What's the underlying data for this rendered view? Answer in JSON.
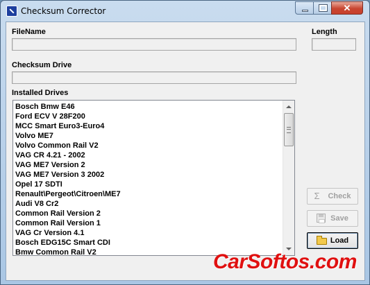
{
  "window": {
    "title": "Checksum Corrector",
    "close_glyph": "✕"
  },
  "fields": {
    "filename_label": "FileName",
    "filename_value": "",
    "length_label": "Length",
    "length_value": "",
    "checksum_drive_label": "Checksum Drive",
    "checksum_drive_value": ""
  },
  "drives": {
    "label": "Installed Drives",
    "items": [
      "Bosch Bmw E46",
      "Ford ECV V 28F200",
      "MCC Smart Euro3-Euro4",
      "Volvo ME7",
      "Volvo Common Rail V2",
      "VAG CR 4.21 - 2002",
      "VAG ME7 Version 2",
      "VAG ME7 Version 3 2002",
      "Opel 17 SDTI",
      "Renault\\Pergeot\\Citroen\\ME7",
      "Audi V8 Cr2",
      "Common Rail Version 2",
      "Common Rail Version 1",
      "VAG Cr Version 4.1",
      "Bosch EDG15C Smart CDI",
      "Bmw Common Rail V2"
    ]
  },
  "buttons": {
    "check_label": "Check",
    "check_icon": "sigma-icon",
    "check_glyph": "Σ",
    "save_label": "Save",
    "save_icon": "floppy-disk-icon",
    "load_label": "Load",
    "load_icon": "open-folder-icon"
  },
  "watermark": "CarSoftos.com",
  "colors": {
    "watermark": "#e01010",
    "disabled_text": "#a0a0a0"
  }
}
